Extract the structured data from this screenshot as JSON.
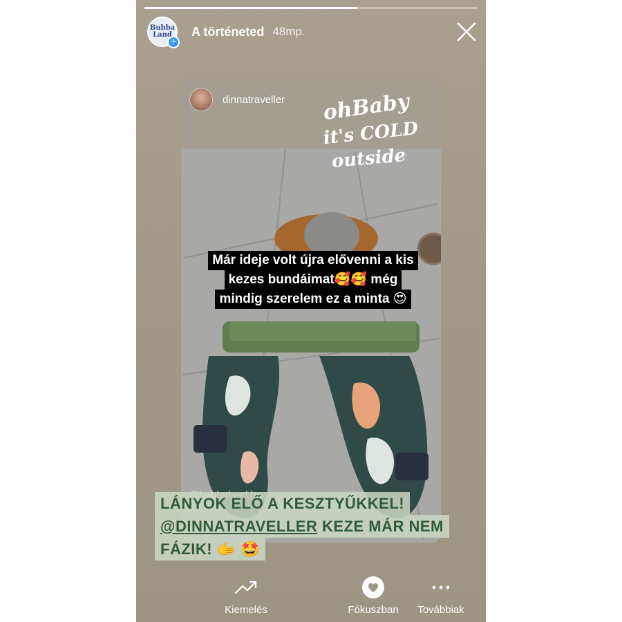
{
  "story": {
    "progress": 0.64,
    "account_logo_text": [
      "Bubba",
      "Land"
    ],
    "title": "A történeted",
    "time": "48mp.",
    "close_icon": "close-icon"
  },
  "reshared_post": {
    "username": "dinnatraveller",
    "sticker_text": [
      "ohBaby",
      "it's COLD",
      "outside"
    ],
    "caption_lines": [
      "Már ideje volt újra elővenni a kis",
      "kezes bundáimat🥰🥰 még",
      "mindig szerelem ez a minta 😍"
    ],
    "watermark": "@bubbaland.hu"
  },
  "story_caption": {
    "line1": "LÁNYOK ELŐ A KESZTYŰKKEL!",
    "line2_mention": "@DINNATRAVELLER",
    "line2_rest": " KEZE MÁR NEM",
    "line3": "FÁZIK! 🫱 🤩"
  },
  "bottom_bar": {
    "buttons": [
      {
        "label": "Kiemelés",
        "icon": "trending-up-icon"
      },
      {
        "label": "Fókuszban",
        "icon": "heart-circle-icon"
      },
      {
        "label": "Továbbiak",
        "icon": "more-icon"
      }
    ]
  },
  "colors": {
    "background": "#a39b8a",
    "caption_bg": "#000000",
    "bottom_caption_bg": "#cbd7c4",
    "bottom_caption_text": "#2e5b3c",
    "plus_badge": "#3897f0"
  }
}
